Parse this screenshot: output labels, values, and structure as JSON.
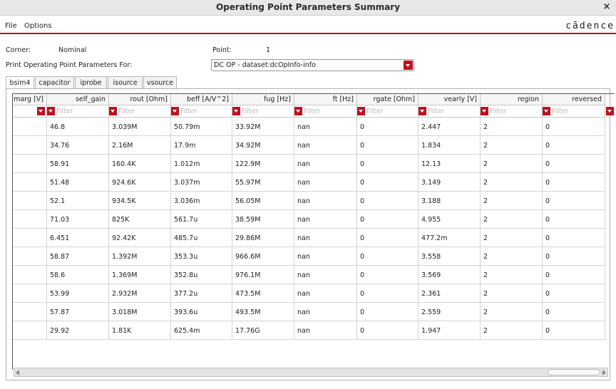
{
  "window": {
    "title": "Operating Point Parameters Summary",
    "close_glyph": "×"
  },
  "menu": {
    "file": "File",
    "options": "Options",
    "logo": "cādence"
  },
  "info": {
    "corner_label": "Corner:",
    "corner_value": "Nominal",
    "point_label": "Point:",
    "point_value": "1",
    "print_label": "Print Operating Point Parameters For:",
    "print_value": "DC OP - dataset:dcOpInfo-info"
  },
  "tabs": [
    "bsim4",
    "capacitor",
    "iprobe",
    "isource",
    "vsource"
  ],
  "active_tab": "bsim4",
  "table": {
    "columns": [
      "marg [V]",
      "self_gain",
      "rout [Ohm]",
      "beff [A/V^2]",
      "fug [Hz]",
      "ft [Hz]",
      "rgate [Ohm]",
      "vearly [V]",
      "region",
      "reversed"
    ],
    "filter_placeholder": "Filter",
    "rows": [
      [
        "",
        "46.8",
        "3.039M",
        "50.79m",
        "33.92M",
        "nan",
        "0",
        "2.447",
        "2",
        "0"
      ],
      [
        "",
        "34.76",
        "2.16M",
        "17.9m",
        "34.92M",
        "nan",
        "0",
        "1.834",
        "2",
        "0"
      ],
      [
        "",
        "58.91",
        "160.4K",
        "1.012m",
        "122.9M",
        "nan",
        "0",
        "12.13",
        "2",
        "0"
      ],
      [
        "",
        "51.48",
        "924.6K",
        "3.037m",
        "55.97M",
        "nan",
        "0",
        "3.149",
        "2",
        "0"
      ],
      [
        "",
        "52.1",
        "934.5K",
        "3.036m",
        "56.05M",
        "nan",
        "0",
        "3.188",
        "2",
        "0"
      ],
      [
        "",
        "71.03",
        "825K",
        "561.7u",
        "38.59M",
        "nan",
        "0",
        "4.955",
        "2",
        "0"
      ],
      [
        "",
        "6.451",
        "92.42K",
        "485.7u",
        "29.86M",
        "nan",
        "0",
        "477.2m",
        "2",
        "0"
      ],
      [
        "",
        "58.87",
        "1.392M",
        "353.3u",
        "966.6M",
        "nan",
        "0",
        "3.558",
        "2",
        "0"
      ],
      [
        "",
        "58.6",
        "1.369M",
        "352.8u",
        "976.1M",
        "nan",
        "0",
        "3.569",
        "2",
        "0"
      ],
      [
        "",
        "53.99",
        "2.932M",
        "377.2u",
        "473.5M",
        "nan",
        "0",
        "2.361",
        "2",
        "0"
      ],
      [
        "",
        "57.87",
        "3.018M",
        "393.6u",
        "493.5M",
        "nan",
        "0",
        "2.559",
        "2",
        "0"
      ],
      [
        "",
        "29.92",
        "1.81K",
        "625.4m",
        "17.76G",
        "nan",
        "0",
        "1.947",
        "2",
        "0"
      ]
    ]
  },
  "colors": {
    "accent_red": "#c01020"
  }
}
